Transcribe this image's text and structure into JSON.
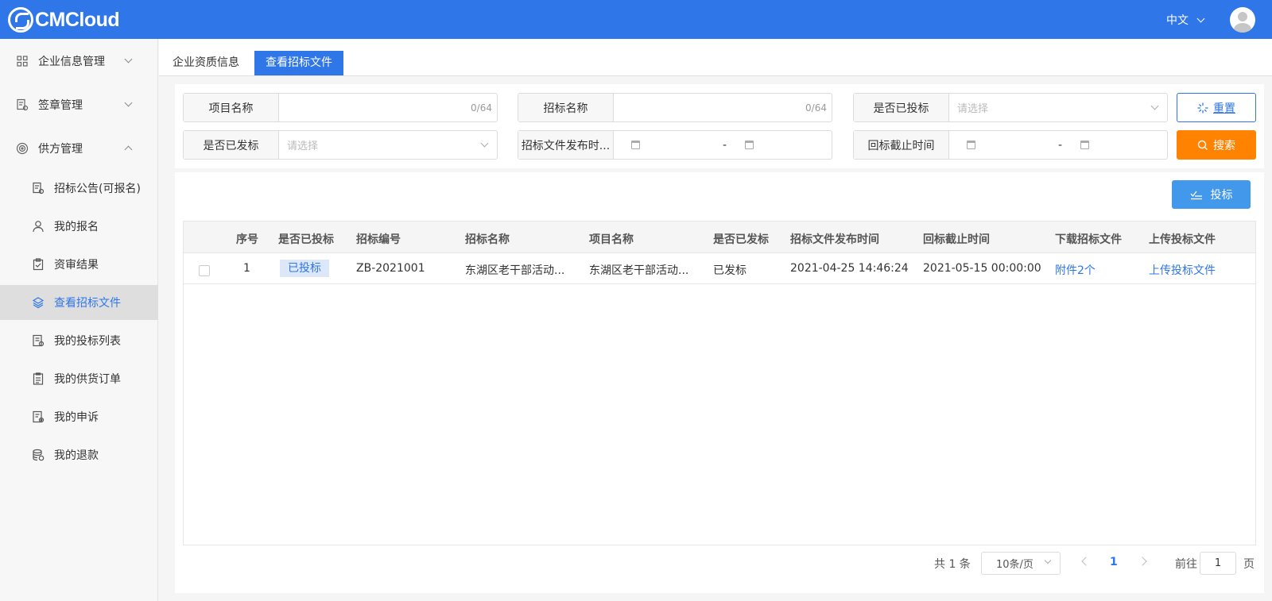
{
  "app": {
    "logo_text": "CMCloud",
    "language": "中文"
  },
  "sidebar": {
    "groups": [
      {
        "label": "企业信息管理"
      },
      {
        "label": "签章管理"
      },
      {
        "label": "供方管理"
      }
    ],
    "items": [
      {
        "label": "招标公告(可报名)"
      },
      {
        "label": "我的报名"
      },
      {
        "label": "资审结果"
      },
      {
        "label": "查看招标文件"
      },
      {
        "label": "我的投标列表"
      },
      {
        "label": "我的供货订单"
      },
      {
        "label": "我的申诉"
      },
      {
        "label": "我的退款"
      }
    ]
  },
  "tabs": [
    {
      "label": "企业资质信息"
    },
    {
      "label": "查看招标文件"
    }
  ],
  "filters": {
    "project_name": {
      "label": "项目名称",
      "count": "0/64"
    },
    "bid_name": {
      "label": "招标名称",
      "count": "0/64"
    },
    "is_bid": {
      "label": "是否已投标",
      "placeholder": "请选择"
    },
    "is_published": {
      "label": "是否已发标",
      "placeholder": "请选择"
    },
    "publish_time": {
      "label": "招标文件发布时...",
      "separator": "-"
    },
    "deadline": {
      "label": "回标截止时间",
      "separator": "-"
    },
    "reset_label": "重置",
    "search_label": "搜索"
  },
  "toolbar": {
    "bid_label": "投标"
  },
  "table": {
    "columns": [
      "序号",
      "是否已投标",
      "招标编号",
      "招标名称",
      "项目名称",
      "是否已发标",
      "招标文件发布时间",
      "回标截止时间",
      "下载招标文件",
      "上传投标文件"
    ],
    "rows": [
      {
        "index": "1",
        "is_bid": "已投标",
        "bid_no": "ZB-2021001",
        "bid_name": "东湖区老干部活动...",
        "project_name": "东湖区老干部活动...",
        "is_published": "已发标",
        "publish_time": "2021-04-25 14:46:24",
        "deadline": "2021-05-15 00:00:00",
        "download": "附件2个",
        "upload": "上传投标文件"
      }
    ]
  },
  "pagination": {
    "total": "共 1 条",
    "page_size": "10条/页",
    "current": "1",
    "goto_label": "前往",
    "goto_value": "1",
    "page_suffix": "页"
  },
  "colors": {
    "primary": "#2f76e8",
    "search": "#ff8300",
    "bid_button": "#4298ea"
  }
}
